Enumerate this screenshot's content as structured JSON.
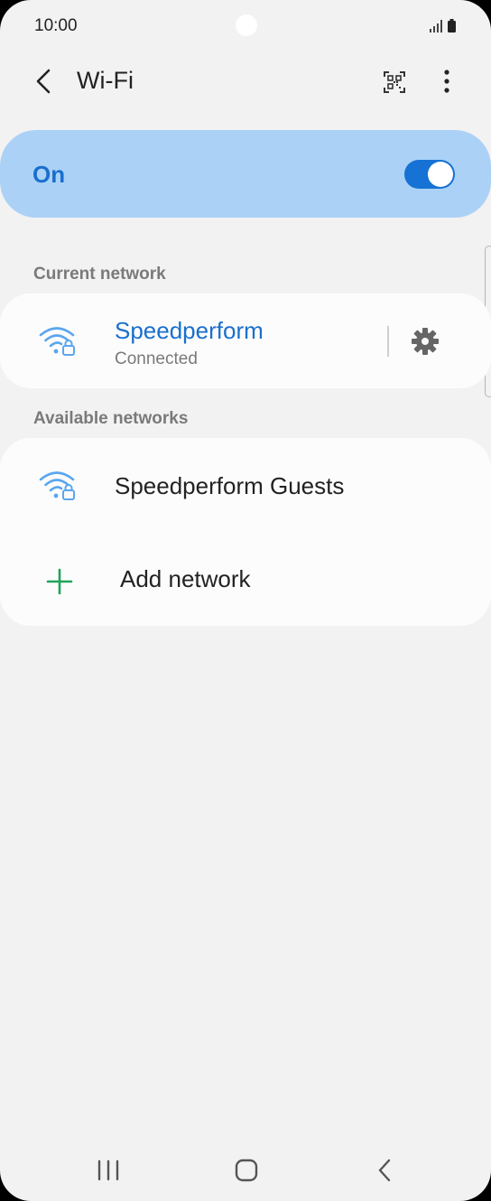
{
  "status_bar": {
    "time": "10:00"
  },
  "app_bar": {
    "title": "Wi-Fi",
    "back_icon": "chevron-left-icon",
    "qr_icon": "qr-code-icon",
    "more_icon": "more-vertical-icon"
  },
  "master_switch": {
    "label": "On",
    "checked": true
  },
  "current_network": {
    "header": "Current network",
    "name": "Speedperform",
    "status": "Connected",
    "icon": "wifi-lock-icon",
    "settings_icon": "gear-icon"
  },
  "available_networks": {
    "header": "Available networks",
    "items": [
      {
        "name": "Speedperform Guests",
        "icon": "wifi-lock-icon"
      }
    ],
    "add_network": {
      "label": "Add network",
      "icon": "plus-icon"
    }
  },
  "nav_bar": {
    "recents_icon": "recents-icon",
    "home_icon": "home-icon",
    "back_icon": "back-icon"
  },
  "colors": {
    "accent": "#1a6fcc",
    "master_card": "#abd1f6",
    "wifi_icon": "#5aa6ee",
    "add_icon": "#1ea35a",
    "background": "#f2f2f2"
  }
}
